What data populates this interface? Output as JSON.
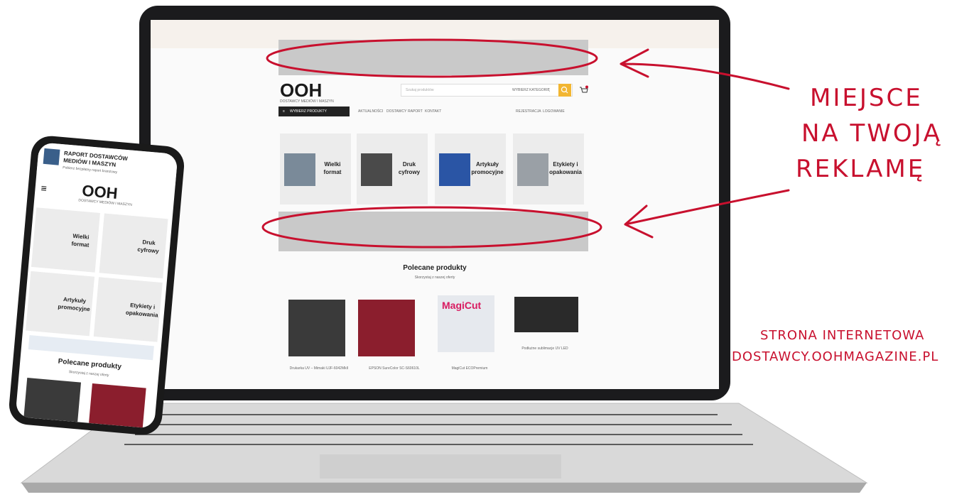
{
  "annotation": {
    "place_line1": "MIEJSCE",
    "place_line2": "NA TWOJĄ",
    "place_line3": "REKLAMĘ",
    "site_line1": "STRONA INTERNETOWA",
    "site_line2": "DOSTAWCY.OOHMAGAZINE.PL",
    "color": "#c8102e"
  },
  "laptop": {
    "logo": "OOH",
    "logo_sub": "DOSTAWCY MEDIÓW I MASZYN",
    "search_placeholder": "Szukaj produktów",
    "search_category": "WYBIERZ KATEGORIĘ",
    "menu_button": "WYBIERZ PRODUKTY",
    "nav": [
      "AKTUALNOŚCI",
      "DOSTAWCY",
      "RAPORT",
      "KONTAKT"
    ],
    "account": [
      "REJESTRACJA",
      "LOGOWANIE"
    ],
    "categories": [
      {
        "label": "Wielki format",
        "icon": "printer-icon"
      },
      {
        "label": "Druk cyfrowy",
        "icon": "printer-icon"
      },
      {
        "label": "Artykuły promocyjne",
        "icon": "printer-icon"
      },
      {
        "label": "Etykiety i opakowania",
        "icon": "printer-icon"
      }
    ],
    "featured_title": "Polecane produkty",
    "featured_sub": "Skorzystaj z naszej oferty",
    "products": [
      "Drukarka UV – Mimaki UJF-6042MkII",
      "EPSON SureColor SC-S60610L",
      "MagiCut ECOPremium",
      "Podłużne sublimacje UV LED"
    ]
  },
  "phone": {
    "header_line1": "RAPORT DOSTAWCÓW",
    "header_line2": "MEDIÓW I MASZYN",
    "header_line3": "Pobierz bezpłatny raport branżowy",
    "logo": "OOH",
    "logo_sub": "DOSTAWCY MEDIÓW I MASZYN",
    "categories": [
      "Wielki format",
      "Druk cyfrowy",
      "Artykuły promocyjne",
      "Etykiety i opakowania"
    ],
    "featured_title": "Polecane produkty",
    "featured_sub": "Skorzystaj z naszej oferty"
  }
}
